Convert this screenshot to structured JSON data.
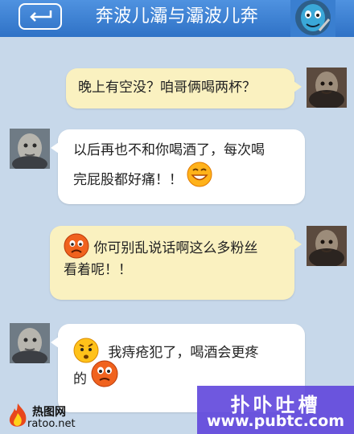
{
  "header": {
    "title": "奔波儿灞与灞波儿奔",
    "back_icon": "back-arrow-icon",
    "colors": {
      "bar": "#3a7fd0",
      "text": "#ffffff"
    }
  },
  "messages": [
    {
      "side": "right",
      "lines": [
        "晚上有空没？咱哥俩喝两杯？"
      ]
    },
    {
      "side": "left",
      "lines": [
        "以后再也不和你喝酒了，每次喝",
        "完屁股都好痛！！"
      ],
      "emoji": "laughing-face-icon"
    },
    {
      "side": "right",
      "lines": [
        "你可别乱说话啊这么多粉丝",
        "看着呢！！"
      ],
      "emoji": "worried-face-icon"
    },
    {
      "side": "left",
      "lines": [
        "我痔疮犯了，喝酒会更疼",
        "的"
      ],
      "emoji": [
        "confused-face-icon",
        "sad-face-icon"
      ]
    }
  ],
  "watermarks": {
    "left_top": "热图网",
    "left_bottom": "ratoo.net",
    "right_title": "扑卟吐槽",
    "right_url": "www.pubtc.com"
  },
  "colors": {
    "background": "#c7d8ea",
    "bubble_right": "#faf1c0",
    "bubble_left": "#ffffff",
    "watermark_purple": "#5f46dc"
  }
}
